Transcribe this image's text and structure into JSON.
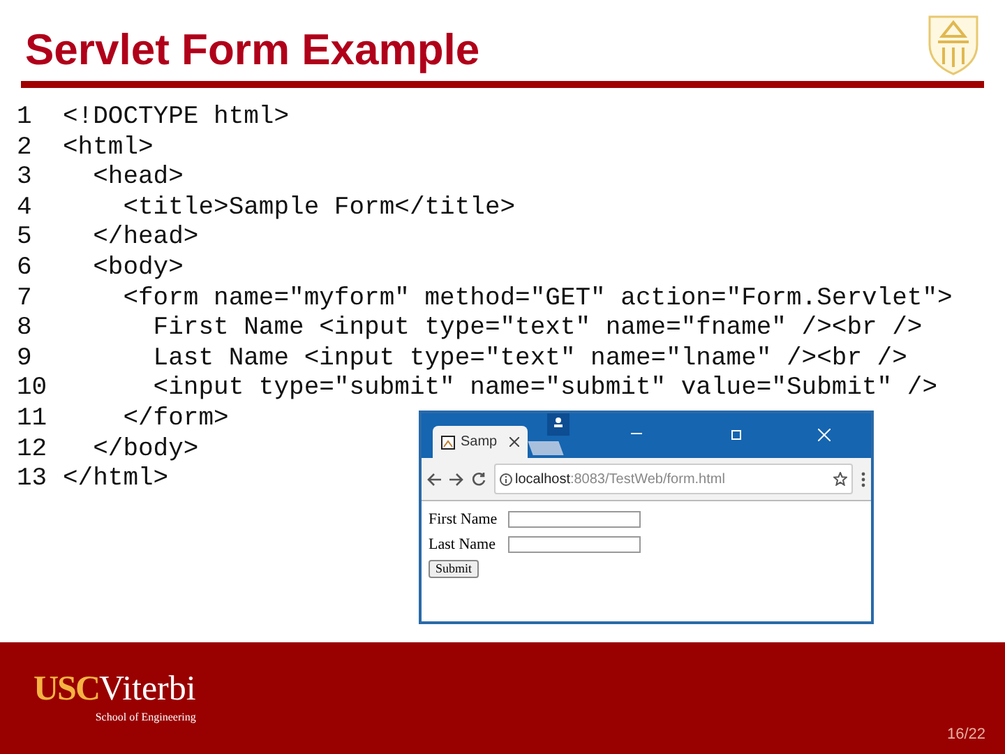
{
  "slide": {
    "title": "Servlet Form Example"
  },
  "code_lines": [
    {
      "number": "1",
      "text": "<!DOCTYPE html>"
    },
    {
      "number": "2",
      "text": "<html>"
    },
    {
      "number": "3",
      "text": "  <head>"
    },
    {
      "number": "4",
      "text": "    <title>Sample Form</title>"
    },
    {
      "number": "5",
      "text": "  </head>"
    },
    {
      "number": "6",
      "text": "  <body>"
    },
    {
      "number": "7",
      "text": "    <form name=\"myform\" method=\"GET\" action=\"Form.Servlet\">"
    },
    {
      "number": "8",
      "text": "      First Name <input type=\"text\" name=\"fname\" /><br />"
    },
    {
      "number": "9",
      "text": "      Last Name <input type=\"text\" name=\"lname\" /><br />"
    },
    {
      "number": "10",
      "text": "      <input type=\"submit\" name=\"submit\" value=\"Submit\" />"
    },
    {
      "number": "11",
      "text": "    </form>"
    },
    {
      "number": "12",
      "text": "  </body>"
    },
    {
      "number": "13",
      "text": "</html>"
    }
  ],
  "browser": {
    "tab_title": "Samp",
    "url_host": "localhost",
    "url_rest": ":8083/TestWeb/form.html",
    "form": {
      "fields": [
        {
          "label": "First Name"
        },
        {
          "label": "Last Name"
        }
      ],
      "submit": "Submit"
    }
  },
  "footer": {
    "logo_usc": "USC",
    "logo_viterbi": "Viterbi",
    "logo_subtitle": "School of Engineering",
    "page": "16/22"
  }
}
